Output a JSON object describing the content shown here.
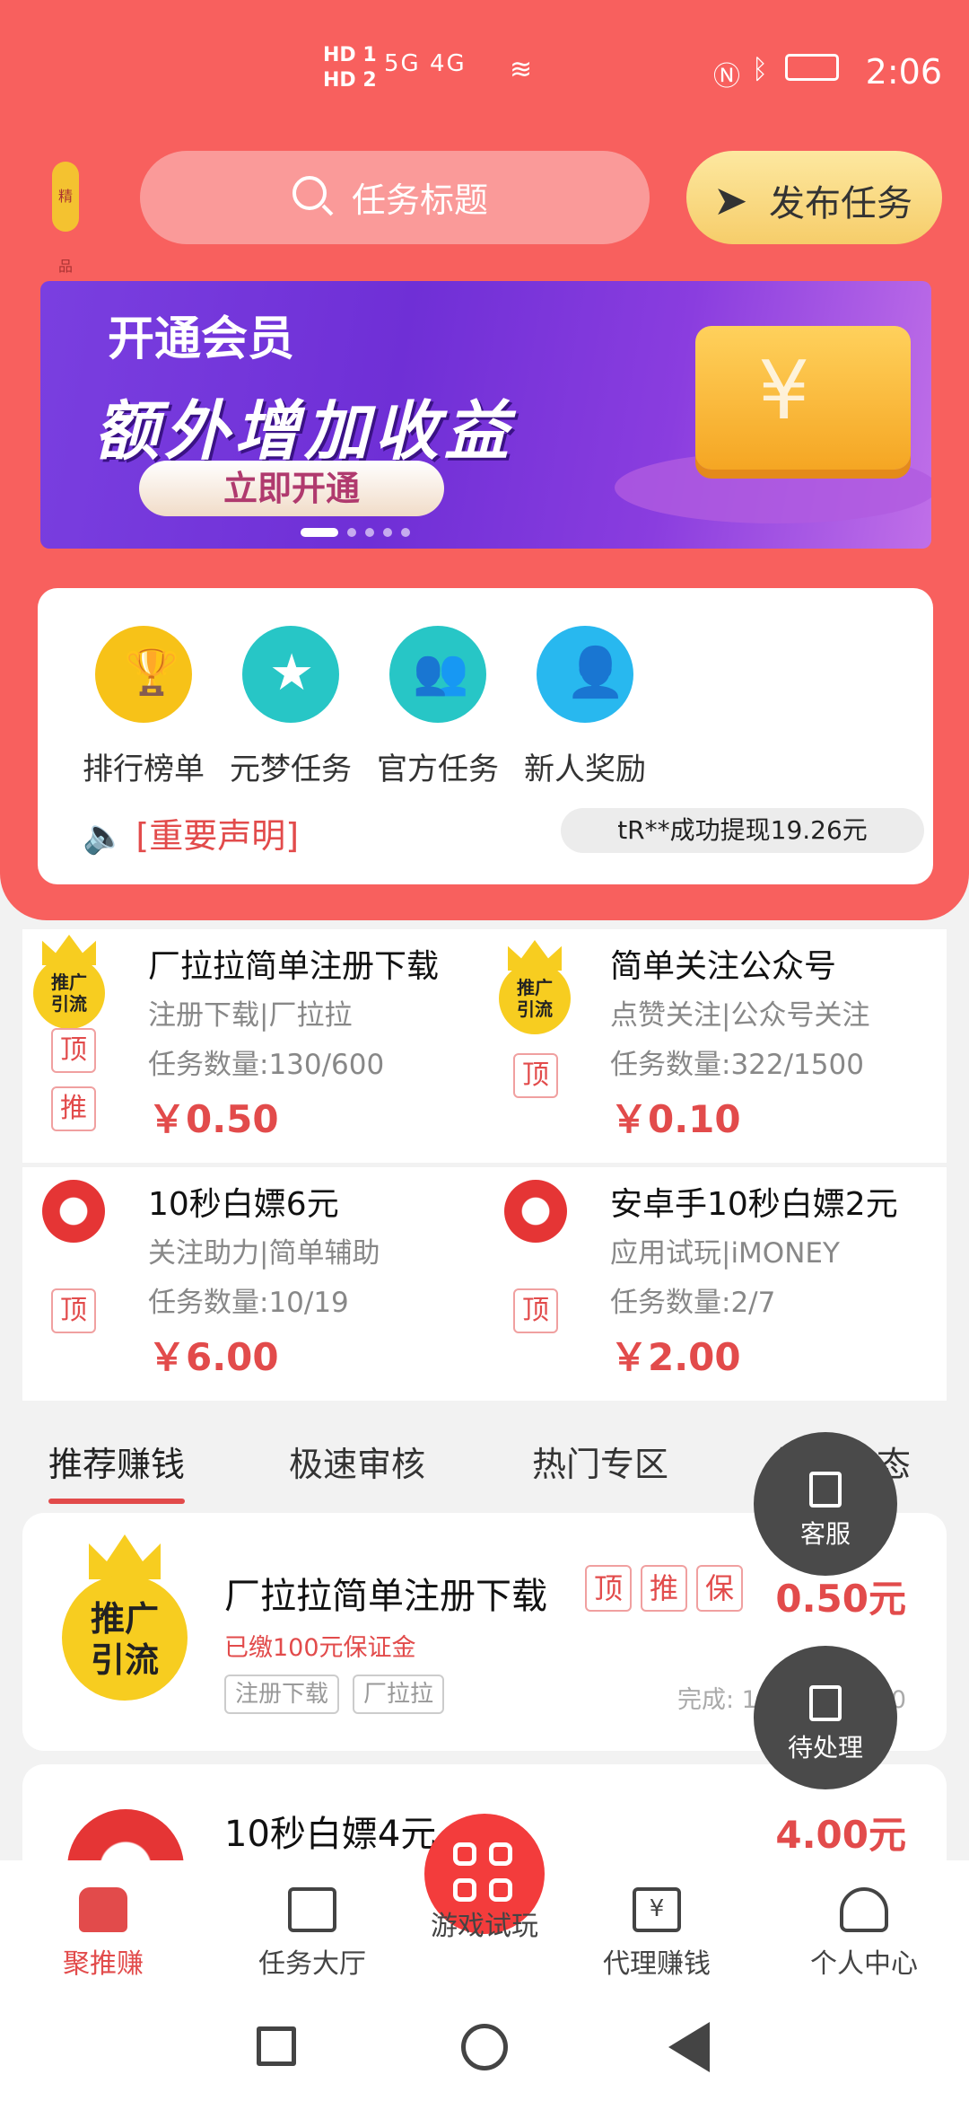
{
  "status_bar": {
    "hd1": "HD 1",
    "hd2": "HD 2",
    "signal": "5G 4G",
    "time": "2:06"
  },
  "header": {
    "search_placeholder": "任务标题",
    "publish_label": "发布任务",
    "logo_text": "精品"
  },
  "banner": {
    "line1": "开通会员",
    "line2": "额外增加收益",
    "cta": "立即开通"
  },
  "quick": [
    {
      "label": "排行榜单",
      "icon": "trophy-icon",
      "color": "#f7c218"
    },
    {
      "label": "元梦任务",
      "icon": "star-icon",
      "color": "#27c6c6"
    },
    {
      "label": "官方任务",
      "icon": "group-icon",
      "color": "#27c6c6"
    },
    {
      "label": "新人奖励",
      "icon": "person-icon",
      "color": "#28b8ef"
    }
  ],
  "announcement": "[重要声明]",
  "notice": "tR**成功提现19.26元",
  "grid_tasks": [
    {
      "title": "厂拉拉简单注册下载",
      "sub": "注册下载|厂拉拉",
      "count": "任务数量:130/600",
      "price": "￥0.50",
      "badge": "推广引流",
      "tags": [
        "顶",
        "推"
      ]
    },
    {
      "title": "简单关注公众号",
      "sub": "点赞关注|公众号关注",
      "count": "任务数量:322/1500",
      "price": "￥0.10",
      "badge": "推广引流",
      "tags": [
        "顶"
      ]
    },
    {
      "title": "10秒白嫖6元",
      "sub": "关注助力|简单辅助",
      "count": "任务数量:10/19",
      "price": "￥6.00",
      "badge": "",
      "tags": [
        "顶"
      ]
    },
    {
      "title": "安卓手10秒白嫖2元",
      "sub": "应用试玩|iMONEY",
      "count": "任务数量:2/7",
      "price": "￥2.00",
      "badge": "",
      "tags": [
        "顶"
      ]
    }
  ],
  "tabs": [
    "推荐赚钱",
    "极速审核",
    "热门专区",
    "好友动态"
  ],
  "list": [
    {
      "title": "厂拉拉简单注册下载",
      "tags": [
        "顶",
        "推",
        "保"
      ],
      "price": "0.50元",
      "deposit": "已缴100元保证金",
      "chips": [
        "注册下载",
        "厂拉拉"
      ],
      "done": "完成: 130    剩余: 470",
      "badge": "推广引流"
    },
    {
      "title": "10秒白嫖4元",
      "price": "4.00元"
    }
  ],
  "floats": {
    "service": "客服",
    "pending": "待处理"
  },
  "bottom_nav": [
    "聚推赚",
    "任务大厅",
    "游戏试玩",
    "代理赚钱",
    "个人中心"
  ]
}
